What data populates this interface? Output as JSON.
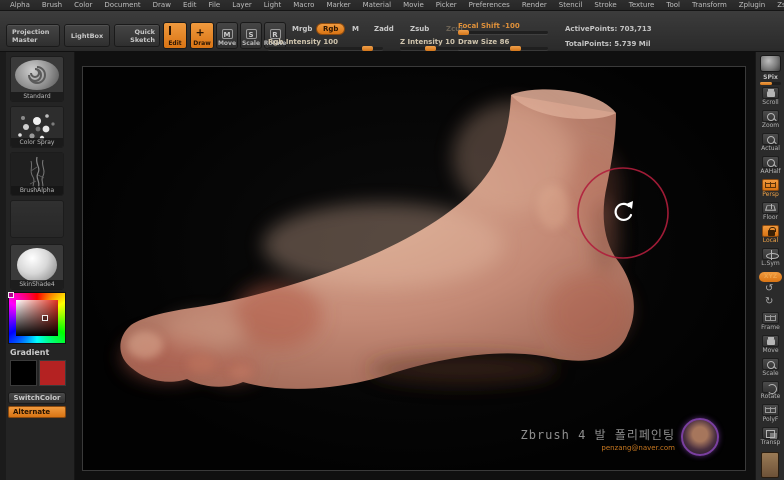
{
  "menubar": {
    "items": [
      "Alpha",
      "Brush",
      "Color",
      "Document",
      "Draw",
      "Edit",
      "File",
      "Layer",
      "Light",
      "Macro",
      "Marker",
      "Material",
      "Movie",
      "Picker",
      "Preferences",
      "Render",
      "Stencil",
      "Stroke",
      "Texture",
      "Tool",
      "Transform",
      "Zplugin",
      "Zscript"
    ]
  },
  "toolbar": {
    "projection_master": "Projection Master",
    "lightbox": "LightBox",
    "quick_sketch": "Quick Sketch",
    "edit": "Edit",
    "draw": "Draw",
    "move": "Move",
    "scale": "Scale",
    "rotate": "Rotate",
    "mrgb": "Mrgb",
    "rgb": "Rgb",
    "m": "M",
    "zadd": "Zadd",
    "zsub": "Zsub",
    "zcut": "Zcut",
    "sliders": {
      "focal_shift_label": "Focal Shift -100",
      "rgb_intensity_label": "Rgb Intensity 100",
      "z_intensity_label": "Z Intensity 10",
      "draw_size_label": "Draw Size 86"
    },
    "stats": {
      "active_points": "ActivePoints: 703,713",
      "total_points": "TotalPoints: 5.739 Mil"
    }
  },
  "left_sidebar": {
    "brush_label": "Standard",
    "stroke_label": "Color Spray",
    "alpha_label": "BrushAlpha",
    "material_label": "SkinShade4",
    "gradient_label": "Gradient",
    "switch_color": "SwitchColor",
    "alternate": "Alternate",
    "main_color": "#000000",
    "secondary_color": "#b42222"
  },
  "right_sidebar": {
    "spix_label": "SPix",
    "items": [
      {
        "label": "Scroll",
        "icon": "hand",
        "active": false
      },
      {
        "label": "Zoom",
        "icon": "magnifier",
        "active": false
      },
      {
        "label": "Actual",
        "icon": "magnifier",
        "active": false
      },
      {
        "label": "AAHalf",
        "icon": "magnifier",
        "active": false
      },
      {
        "label": "Persp",
        "icon": "persp",
        "active": true
      },
      {
        "label": "Floor",
        "icon": "floor",
        "active": false
      },
      {
        "label": "Local",
        "icon": "lock",
        "active": true
      },
      {
        "label": "L.Sym",
        "icon": "sym",
        "active": false
      },
      {
        "label": "XYZ",
        "icon": "xyz",
        "active": true
      },
      {
        "label": "",
        "icon": "rotccw",
        "active": false
      },
      {
        "label": "",
        "icon": "rotcw",
        "active": false
      },
      {
        "label": "Frame",
        "icon": "frame",
        "active": false
      },
      {
        "label": "Move",
        "icon": "hand",
        "active": false
      },
      {
        "label": "Scale",
        "icon": "magnifier",
        "active": false
      },
      {
        "label": "Rotate",
        "icon": "rotate",
        "active": false
      },
      {
        "label": "PolyF",
        "icon": "grid",
        "active": false
      },
      {
        "label": "Transp",
        "icon": "transp",
        "active": false
      }
    ]
  },
  "canvas": {
    "watermark_title": "Zbrush 4 발 폴리페인팅",
    "watermark_email": "penzang@naver.com"
  },
  "colors": {
    "accent_orange": "#e8821e",
    "cursor_red": "#b01e3c"
  }
}
